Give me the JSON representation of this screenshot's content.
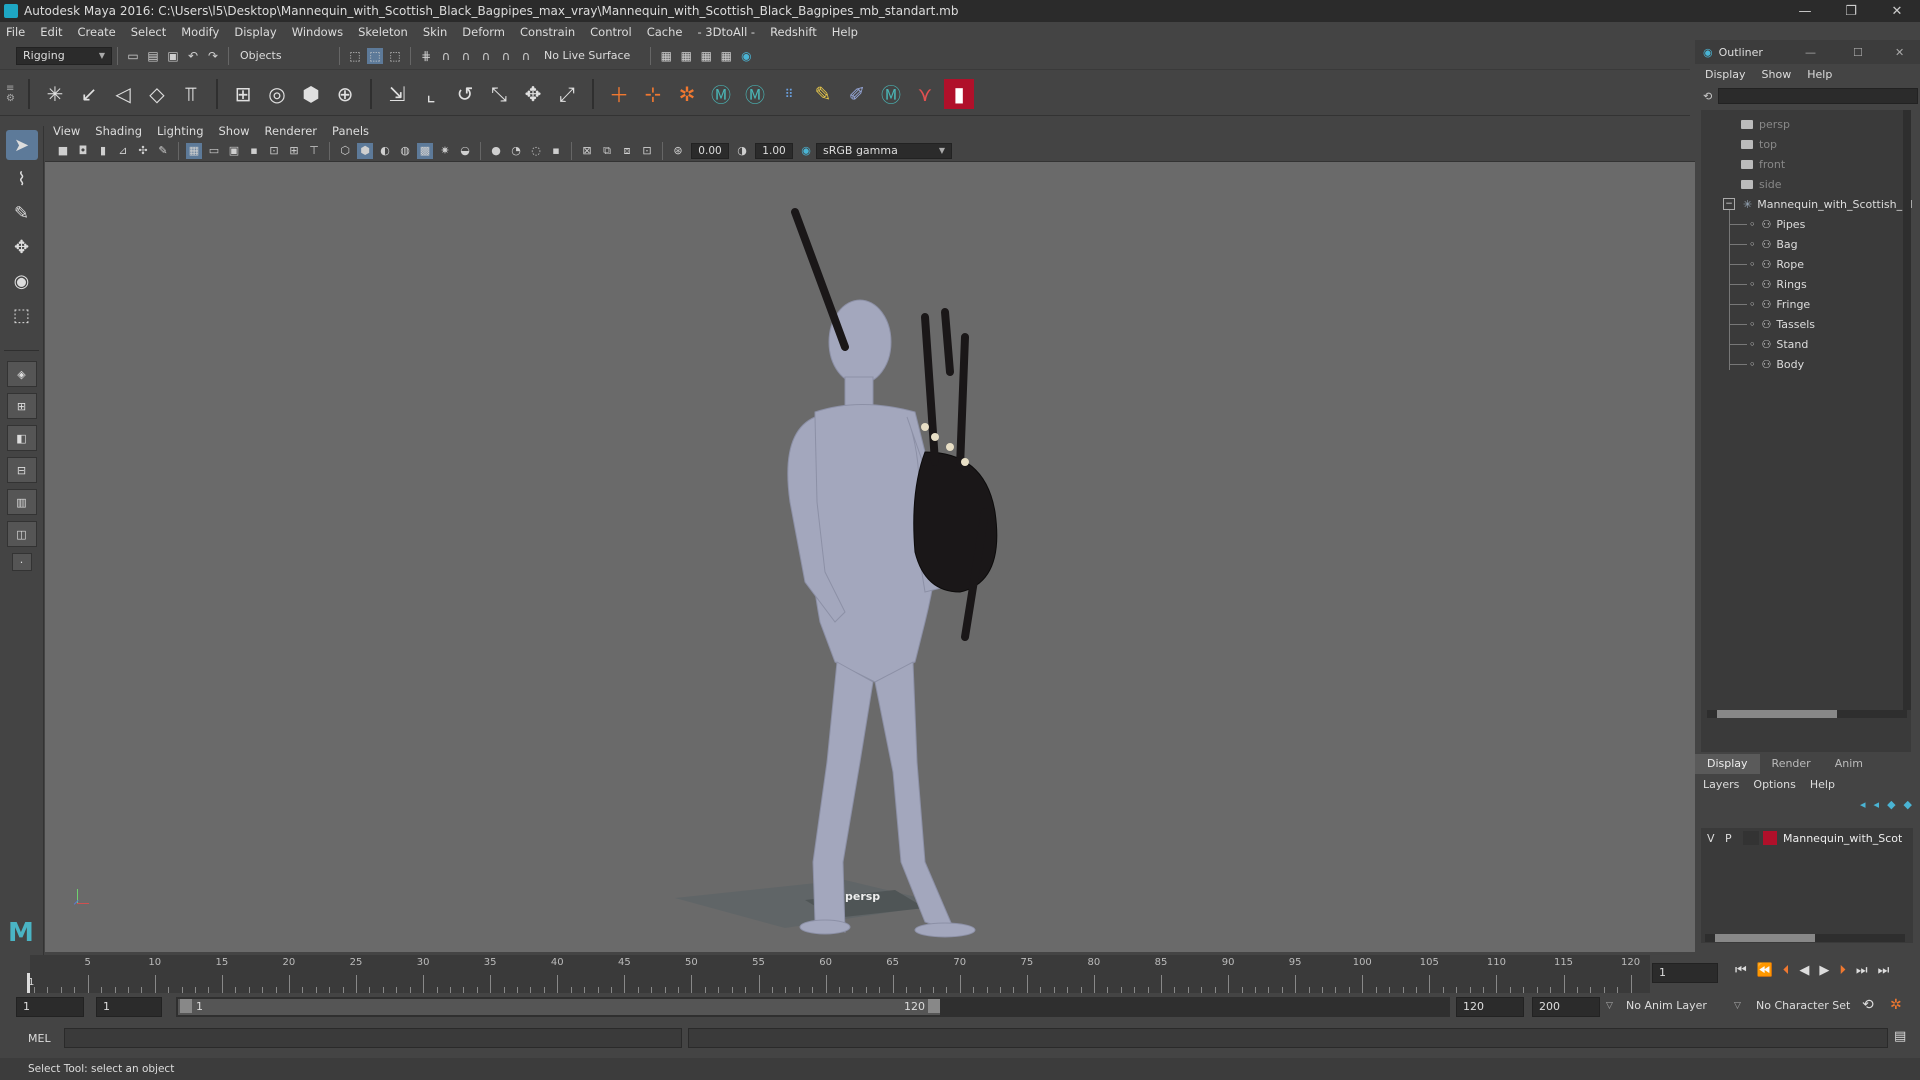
{
  "window": {
    "title": "Autodesk Maya 2016: C:\\Users\\l5\\Desktop\\Mannequin_with_Scottish_Black_Bagpipes_max_vray\\Mannequin_with_Scottish_Black_Bagpipes_mb_standart.mb",
    "controls": [
      "—",
      "❐",
      "✕"
    ]
  },
  "menubar": [
    "File",
    "Edit",
    "Create",
    "Select",
    "Modify",
    "Display",
    "Windows",
    "Skeleton",
    "Skin",
    "Deform",
    "Constrain",
    "Control",
    "Cache",
    "- 3DtoAll -",
    "Redshift",
    "Help"
  ],
  "statusline": {
    "mode": "Rigging",
    "select_mode": "Objects",
    "live_surface": "No Live Surface"
  },
  "viewport": {
    "menu": [
      "View",
      "Shading",
      "Lighting",
      "Show",
      "Renderer",
      "Panels"
    ],
    "exposure": "0.00",
    "gamma": "1.00",
    "color_space": "sRGB gamma",
    "camera_label": "persp"
  },
  "outliner": {
    "title": "Outliner",
    "menu": [
      "Display",
      "Show",
      "Help"
    ],
    "cameras": [
      "persp",
      "top",
      "front",
      "side"
    ],
    "root": "Mannequin_with_Scottish_Bl",
    "children": [
      "Pipes",
      "Bag",
      "Rope",
      "Rings",
      "Fringe",
      "Tassels",
      "Stand",
      "Body"
    ]
  },
  "layers": {
    "tabs": [
      "Display",
      "Render",
      "Anim"
    ],
    "active_tab": "Display",
    "menu": [
      "Layers",
      "Options",
      "Help"
    ],
    "layer": {
      "v": "V",
      "p": "P",
      "name": "Mannequin_with_Scot",
      "color": "#b0102a"
    }
  },
  "timeline": {
    "ticks": [
      "5",
      "10",
      "15",
      "20",
      "25",
      "30",
      "35",
      "40",
      "45",
      "50",
      "55",
      "60",
      "65",
      "70",
      "75",
      "80",
      "85",
      "90",
      "95",
      "100",
      "105",
      "110",
      "115",
      "120"
    ],
    "start_label": "1",
    "current_frame": "1"
  },
  "range": {
    "start": "1",
    "playback_start": "1",
    "slider_start": "1",
    "slider_end": "120",
    "playback_end": "120",
    "end": "200",
    "anim_layer": "No Anim Layer",
    "character_set": "No Character Set"
  },
  "command": {
    "label": "MEL"
  },
  "help": "Select Tool: select an object",
  "colors": {
    "background": "#444444",
    "viewport": "#6a6a6a",
    "mannequin": "#a3a7bd",
    "bagpipe": "#1a1718"
  }
}
